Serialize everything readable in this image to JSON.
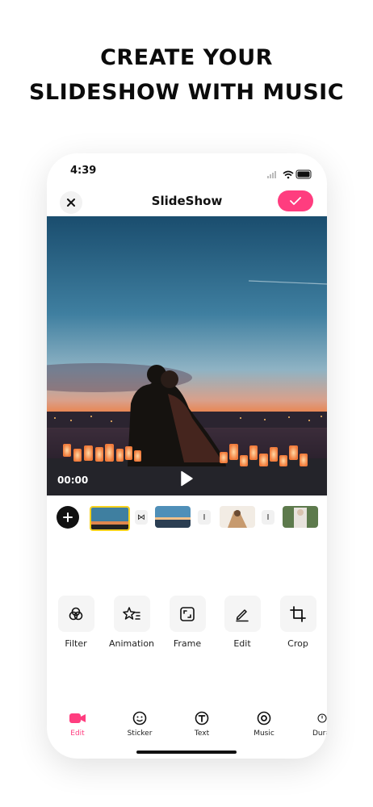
{
  "headline": {
    "line1": "CREATE YOUR",
    "line2": "SLIDESHOW WITH MUSIC"
  },
  "status": {
    "time": "4:39"
  },
  "editor": {
    "title": "SlideShow"
  },
  "preview": {
    "time": "00:00"
  },
  "timeline": {
    "transitions": [
      "⋈",
      "I",
      "I"
    ]
  },
  "tools": [
    {
      "label": "Filter",
      "icon": "filter-icon"
    },
    {
      "label": "Animation",
      "icon": "animation-icon"
    },
    {
      "label": "Frame",
      "icon": "frame-icon"
    },
    {
      "label": "Edit",
      "icon": "edit-icon"
    },
    {
      "label": "Crop",
      "icon": "crop-icon"
    }
  ],
  "tabs": [
    {
      "label": "Edit",
      "icon": "video-icon",
      "active": true
    },
    {
      "label": "Sticker",
      "icon": "smiley-icon"
    },
    {
      "label": "Text",
      "icon": "text-icon"
    },
    {
      "label": "Music",
      "icon": "music-icon"
    },
    {
      "label": "Dura",
      "icon": "duration-icon"
    }
  ],
  "colors": {
    "accent": "#ff3d7f",
    "selection": "#f7d21e"
  }
}
